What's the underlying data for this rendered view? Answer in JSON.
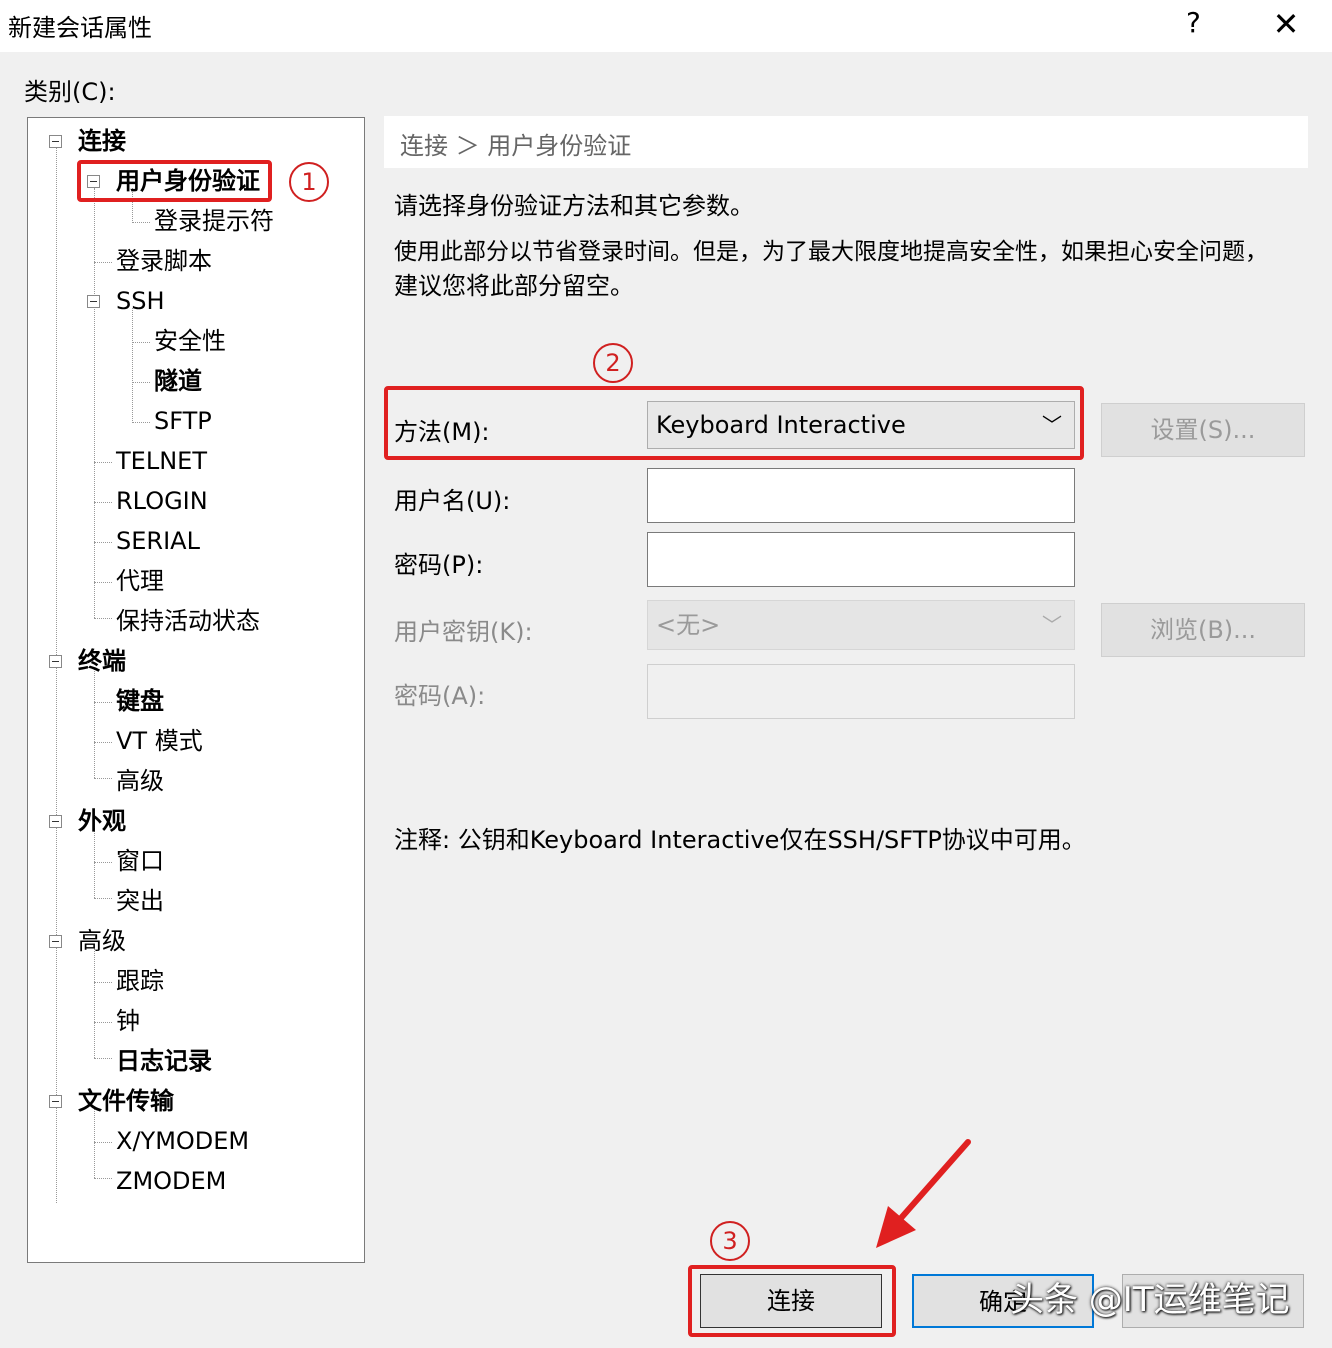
{
  "window": {
    "title": "新建会话属性",
    "help": "?",
    "close": "✕"
  },
  "category_label": "类别(C):",
  "tree": {
    "connection": "连接",
    "auth": "用户身份验证",
    "login_prompts": "登录提示符",
    "login_script": "登录脚本",
    "ssh": "SSH",
    "security": "安全性",
    "tunnel": "隧道",
    "sftp": "SFTP",
    "telnet": "TELNET",
    "rlogin": "RLOGIN",
    "serial": "SERIAL",
    "proxy": "代理",
    "keepalive": "保持活动状态",
    "terminal": "终端",
    "keyboard": "键盘",
    "vt_mode": "VT 模式",
    "term_advanced": "高级",
    "appearance": "外观",
    "window": "窗口",
    "highlight": "突出",
    "advanced": "高级",
    "trace": "跟踪",
    "bell": "钟",
    "logging": "日志记录",
    "file_transfer": "文件传输",
    "xymodem": "X/YMODEM",
    "zmodem": "ZMODEM"
  },
  "breadcrumb": "连接 ＞ 用户身份验证",
  "description1": "请选择身份验证方法和其它参数。",
  "description2": "使用此部分以节省登录时间。但是，为了最大限度地提高安全性，如果担心安全问题，",
  "description3": "建议您将此部分留空。",
  "form": {
    "method_label": "方法(M):",
    "method_value": "Keyboard Interactive",
    "settings_button": "设置(S)...",
    "username_label": "用户名(U):",
    "username_value": "",
    "password_label": "密码(P):",
    "password_value": "",
    "userkey_label": "用户密钥(K):",
    "userkey_value": "<无>",
    "browse_button": "浏览(B)...",
    "passphrase_label": "密码(A):",
    "passphrase_value": ""
  },
  "note": "注释: 公钥和Keyboard Interactive仅在SSH/SFTP协议中可用。",
  "buttons": {
    "connect": "连接",
    "ok": "确定",
    "cancel": ""
  },
  "annotations": {
    "n1": "1",
    "n2": "2",
    "n3": "3",
    "accent": "#e02020"
  },
  "watermark": "头条 @IT运维笔记"
}
